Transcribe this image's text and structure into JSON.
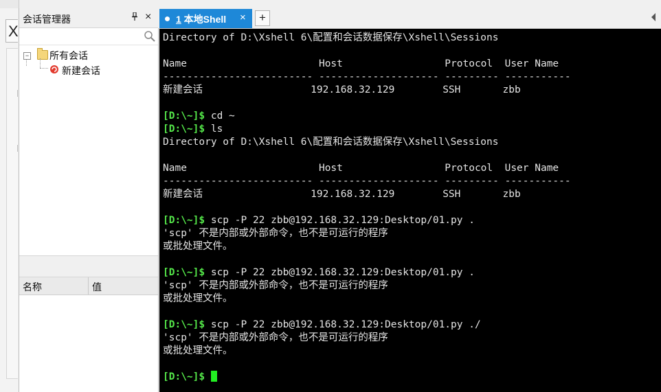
{
  "sidebar_strip": {
    "x_label": "X"
  },
  "session_manager": {
    "title": "会话管理器",
    "pin_glyph": "⊥",
    "close_glyph": "×",
    "tree": {
      "root_label": "所有会话",
      "root_expander": "−",
      "child_label": "新建会话"
    },
    "properties": {
      "col_name": "名称",
      "col_value": "值"
    }
  },
  "tabs": {
    "active": {
      "number": "1",
      "label": " 本地Shell",
      "close_glyph": "×"
    },
    "new_tab_glyph": "+"
  },
  "colors": {
    "tab_active": "#1e88d8",
    "prompt": "#55e84a",
    "cursor": "#22ee22",
    "terminal_bg": "#000000"
  },
  "terminal": {
    "prompt": "[D:\\~]$",
    "lines": [
      "Directory of D:\\Xshell 6\\配置和会话数据保存\\Xshell\\Sessions",
      "",
      "Name                      Host                 Protocol  User Name",
      "------------------------- -------------------- --------- -----------",
      "新建会话                  192.168.32.129        SSH       zbb",
      "",
      " cd ~",
      " ls",
      "Directory of D:\\Xshell 6\\配置和会话数据保存\\Xshell\\Sessions",
      "",
      "Name                      Host                 Protocol  User Name",
      "------------------------- -------------------- --------- -----------",
      "新建会话                  192.168.32.129        SSH       zbb",
      "",
      " scp -P 22 zbb@192.168.32.129:Desktop/01.py .",
      "'scp' 不是内部或外部命令，也不是可运行的程序",
      "或批处理文件。",
      "",
      " scp -P 22 zbb@192.168.32.129:Desktop/01.py .",
      "'scp' 不是内部或外部命令，也不是可运行的程序",
      "或批处理文件。",
      "",
      " scp -P 22 zbb@192.168.32.129:Desktop/01.py ./",
      "'scp' 不是内部或外部命令，也不是可运行的程序",
      "或批处理文件。",
      "",
      " "
    ]
  }
}
